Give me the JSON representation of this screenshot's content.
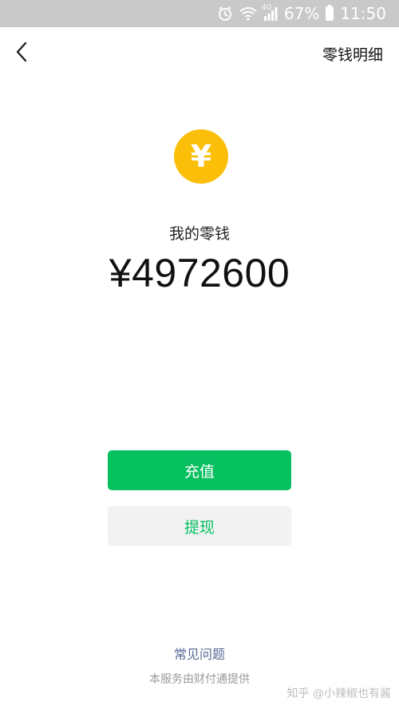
{
  "status_bar": {
    "signal_label": "4G",
    "battery_percent": "67%",
    "time": "11:50",
    "icons": [
      "alarm-icon",
      "wifi-icon",
      "signal-icon",
      "battery-icon"
    ]
  },
  "header": {
    "back_icon": "chevron-left-icon",
    "details_link": "零钱明细"
  },
  "wallet": {
    "coin_symbol": "¥",
    "label": "我的零钱",
    "amount": "¥4972600"
  },
  "actions": {
    "top_up": "充值",
    "withdraw": "提现"
  },
  "footer": {
    "faq": "常见问题",
    "provider": "本服务由财付通提供"
  },
  "watermark": "知乎 @小辣椒也有酱",
  "colors": {
    "primary_green": "#07c160",
    "coin_yellow": "#fbbf0a",
    "link_blue": "#576b95",
    "status_bar_gray": "#c9c9c9"
  }
}
